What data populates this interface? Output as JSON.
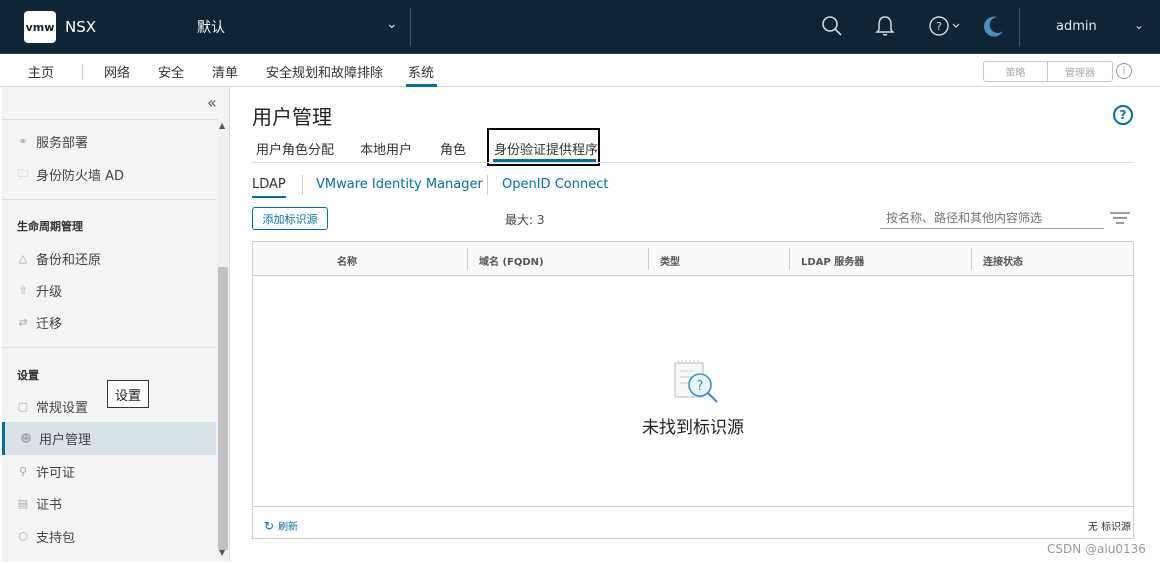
{
  "header": {
    "logo": "vmw",
    "brand": "NSX",
    "context": "默认",
    "user": "admin"
  },
  "nav": {
    "items": [
      "主页",
      "网络",
      "安全",
      "清单",
      "安全规划和故障排除",
      "系统"
    ],
    "active": "系统",
    "mode_buttons": [
      "策略",
      "管理器"
    ],
    "info": "i"
  },
  "sidebar": {
    "items_top": [
      "服务部署",
      "身份防火墙 AD"
    ],
    "lifecycle_heading": "生命周期管理",
    "lifecycle_items": [
      "备份和还原",
      "升级",
      "迁移"
    ],
    "settings_heading": "设置",
    "settings_items": [
      "常规设置",
      "用户管理",
      "许可证",
      "证书",
      "支持包"
    ],
    "active_item": "用户管理",
    "tooltip": "设置"
  },
  "main": {
    "title": "用户管理",
    "help": "?",
    "tabs": [
      "用户角色分配",
      "本地用户",
      "角色",
      "身份验证提供程序"
    ],
    "active_tab": "身份验证提供程序",
    "subtabs": [
      "LDAP",
      "VMware Identity Manager",
      "OpenID Connect"
    ],
    "active_subtab": "LDAP",
    "add_button": "添加标识源",
    "max_label": "最大: 3",
    "filter_placeholder": "按名称、路径和其他内容筛选",
    "columns": [
      "名称",
      "域名 (FQDN)",
      "类型",
      "LDAP 服务器",
      "连接状态"
    ],
    "empty_text": "未找到标识源",
    "refresh_label": "刷新",
    "footer_count": "无 标识源"
  },
  "watermark": "CSDN @alu0136",
  "colors": {
    "header_bg": "#0f2536",
    "accent": "#0072a3",
    "sidebar_bg": "#f4f4f4",
    "sidebar_active_bg": "#d8e3e9"
  }
}
